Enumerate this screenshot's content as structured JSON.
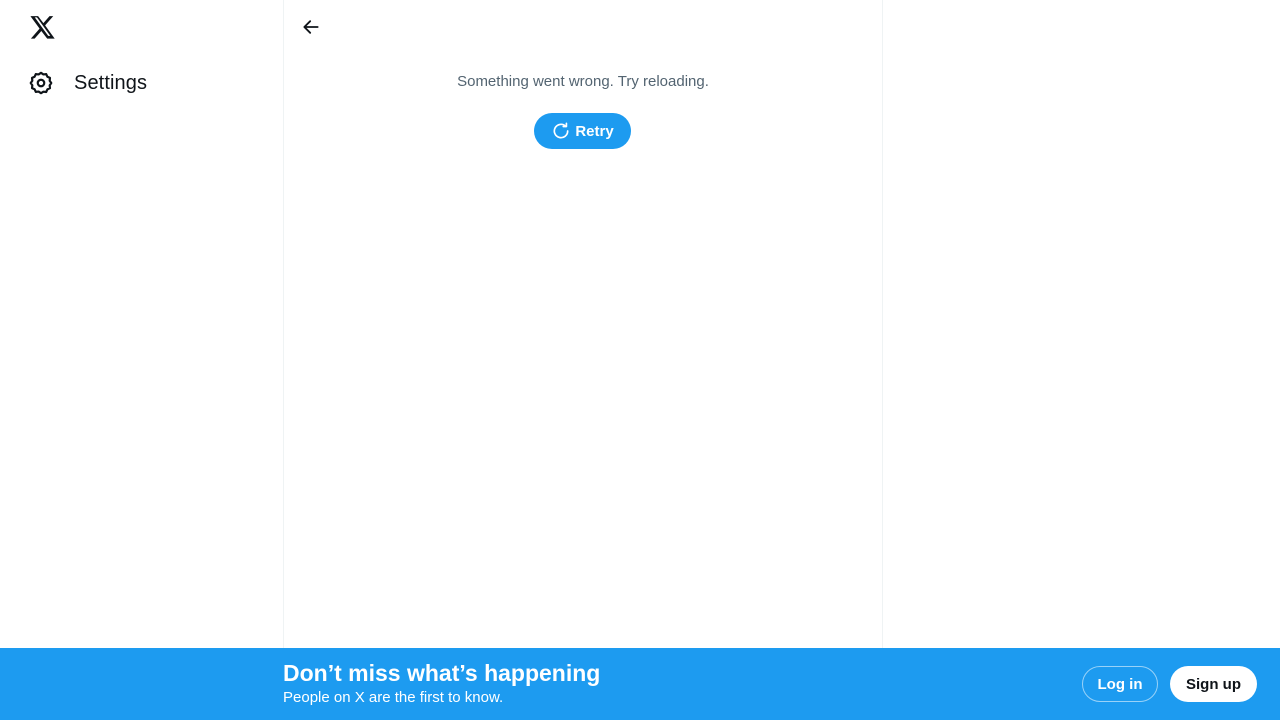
{
  "sidebar": {
    "logo_icon": "x-logo-icon",
    "items": [
      {
        "label": "Settings",
        "icon": "gear-icon"
      }
    ]
  },
  "main": {
    "back_icon": "arrow-left-icon",
    "error_message": "Something went wrong. Try reloading.",
    "retry_label": "Retry",
    "retry_icon": "refresh-icon"
  },
  "banner": {
    "title": "Don’t miss what’s happening",
    "subtitle": "People on X are the first to know.",
    "login_label": "Log in",
    "signup_label": "Sign up"
  },
  "colors": {
    "accent": "#1d9bf0",
    "text_primary": "#0f1419",
    "text_secondary": "#536471",
    "border": "#eff3f4"
  }
}
